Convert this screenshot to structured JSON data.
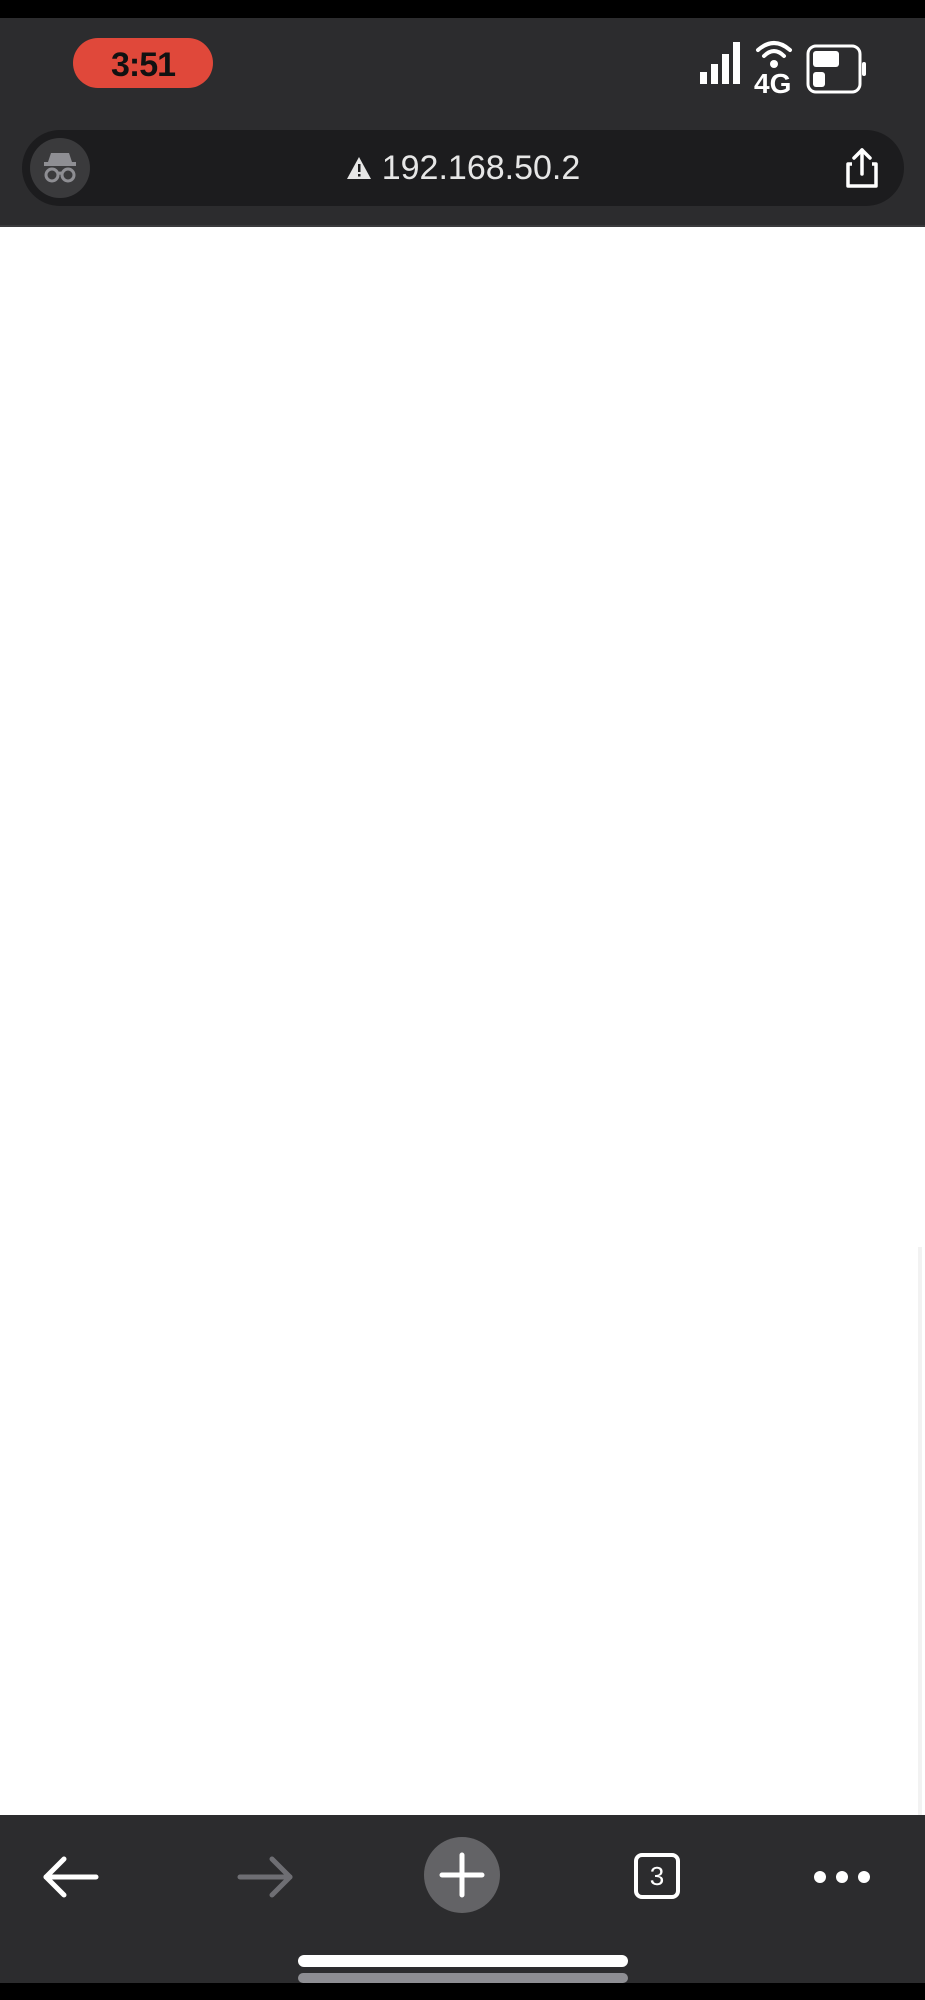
{
  "status_bar": {
    "time": "3:51",
    "network": "4G",
    "colors": {
      "time_pill": "#e0483a"
    }
  },
  "address_bar": {
    "url": "192.168.50.2",
    "security_icon": "warning-triangle-icon",
    "left_icon": "incognito-icon",
    "right_icon": "share-icon"
  },
  "toolbar": {
    "back_icon": "arrow-left-icon",
    "forward_icon": "arrow-right-icon",
    "new_tab_icon": "plus-icon",
    "tab_count": "3",
    "more_icon": "ellipsis-icon"
  },
  "theme": {
    "chrome_bg": "#2c2c2e",
    "content_bg": "#ffffff"
  }
}
